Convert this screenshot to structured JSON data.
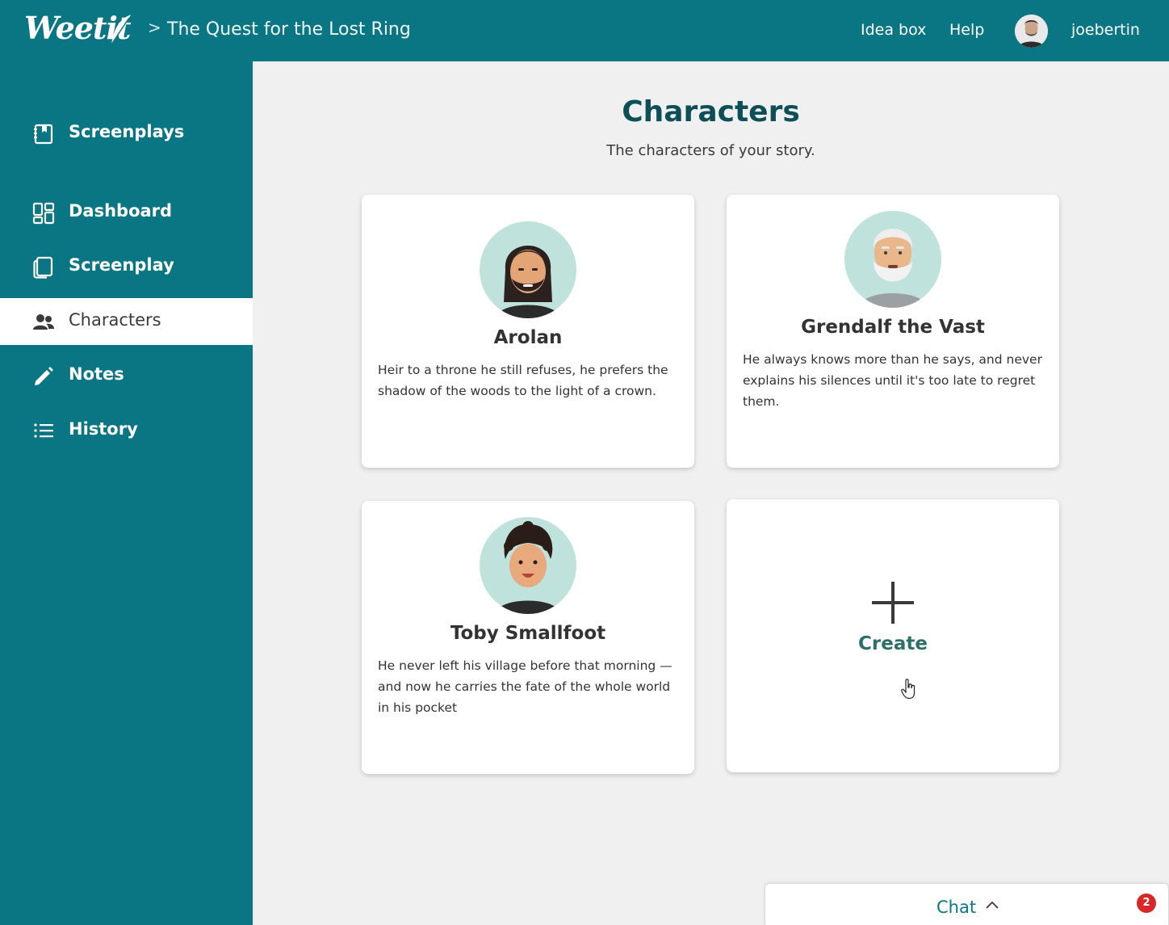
{
  "header": {
    "logo_text": "Weetit",
    "breadcrumb_separator": ">",
    "project_title": "The Quest for the Lost Ring",
    "links": {
      "idea_box": "Idea box",
      "help": "Help"
    },
    "username": "joebertin"
  },
  "sidebar": {
    "items": [
      {
        "label": "Screenplays",
        "icon": "book-icon"
      },
      {
        "label": "Dashboard",
        "icon": "grid-icon"
      },
      {
        "label": "Screenplay",
        "icon": "document-icon"
      },
      {
        "label": "Characters",
        "icon": "users-icon",
        "active": true
      },
      {
        "label": "Notes",
        "icon": "pencil-icon"
      },
      {
        "label": "History",
        "icon": "list-icon"
      }
    ]
  },
  "main": {
    "title": "Characters",
    "subtitle": "The characters of your story.",
    "characters": [
      {
        "name": "Arolan",
        "description": "Heir to a throne he still refuses, he prefers the shadow of the woods to the light of a crown."
      },
      {
        "name": "Grendalf the Vast",
        "description": "He always knows more than he says, and never explains his silences until it's too late to regret them."
      },
      {
        "name": "Toby Smallfoot",
        "description": "He never left his village before that morning — and now he carries the fate of the whole world in his pocket"
      }
    ],
    "create_label": "Create"
  },
  "chat": {
    "label": "Chat",
    "unread_count": "2"
  },
  "colors": {
    "brand_teal": "#0b7683",
    "title_dark_teal": "#0e4f57",
    "badge_red": "#d62828",
    "avatar_bg": "#bfe3dc"
  }
}
